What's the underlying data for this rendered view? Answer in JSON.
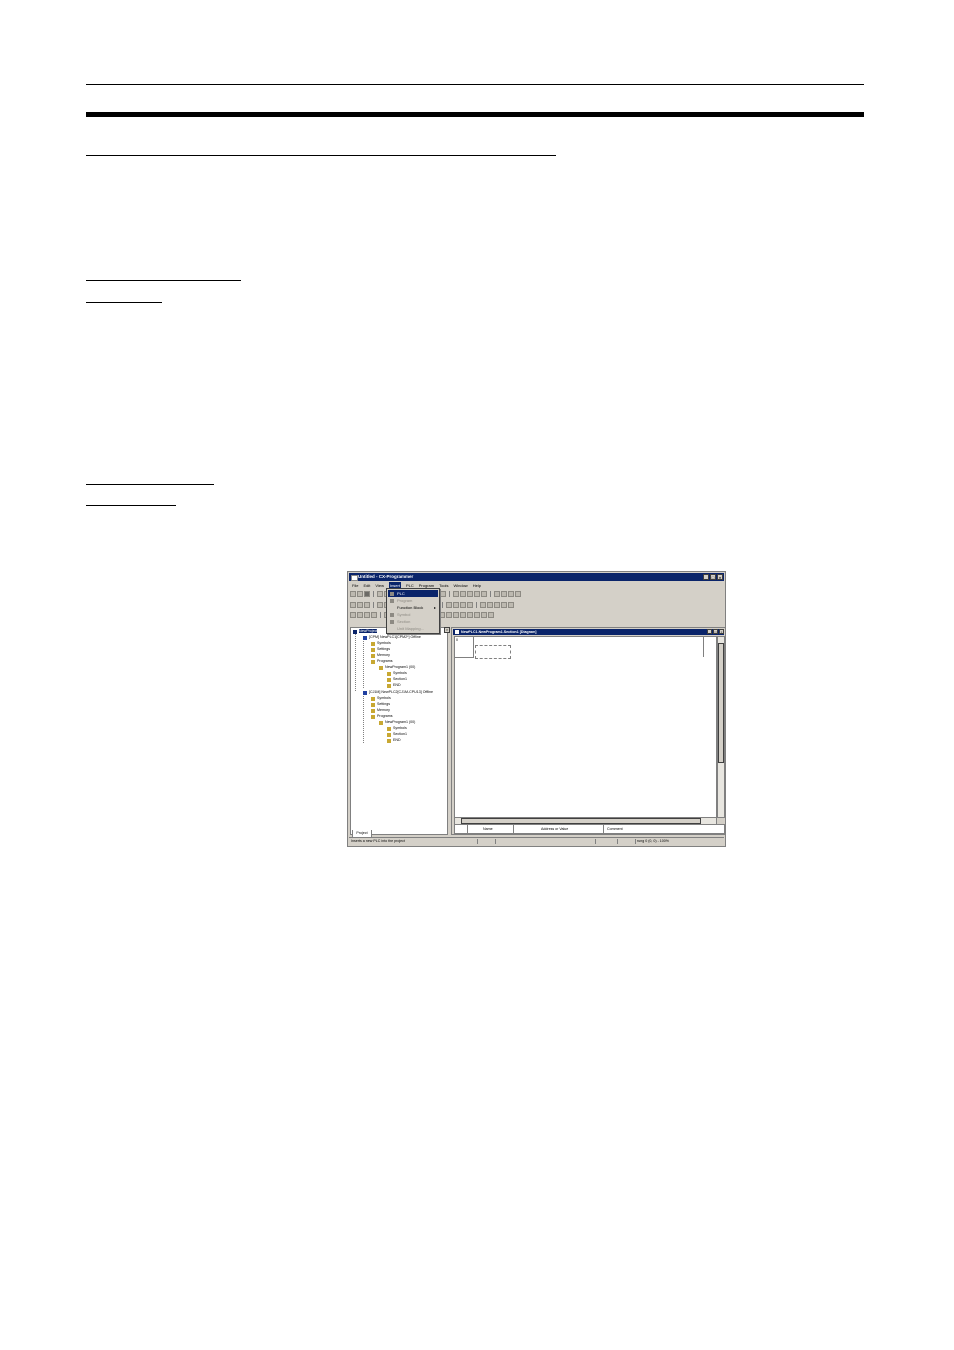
{
  "page": {
    "header_rule": "thin",
    "heading_rule": "thick"
  },
  "screenshot": {
    "window_title": "Untitled - CX-Programmer",
    "window_buttons": [
      "_",
      "□",
      "×"
    ],
    "menu": [
      "File",
      "Edit",
      "View",
      "Insert",
      "PLC",
      "Program",
      "Tools",
      "Window",
      "Help"
    ],
    "active_menu": "Insert",
    "insert_menu_items": [
      {
        "label": "PLC",
        "state": "selected"
      },
      {
        "label": "Program",
        "state": "disabled"
      },
      {
        "label": "Function Block",
        "state": "normal",
        "submenu": true
      },
      {
        "label": "Symbol",
        "state": "disabled"
      },
      {
        "label": "Section",
        "state": "disabled"
      },
      {
        "label": "Unit Mapping...",
        "state": "disabled"
      }
    ],
    "tree": {
      "root": "NewProject",
      "nodes": [
        {
          "label": "[CPM] NewPLC1[CPM2*] Offline",
          "icon": "plc-icon"
        },
        {
          "label": "Symbols",
          "icon": "symbols-icon"
        },
        {
          "label": "Settings",
          "icon": "settings-icon"
        },
        {
          "label": "Memory",
          "icon": "memory-icon"
        },
        {
          "label": "Programs",
          "icon": "programs-icon"
        },
        {
          "label": "NewProgram1 (00)",
          "icon": "program-icon"
        },
        {
          "label": "Symbols",
          "icon": "symbols-icon"
        },
        {
          "label": "Section1",
          "icon": "section-icon"
        },
        {
          "label": "END",
          "icon": "section-icon"
        },
        {
          "label": "[CJ1M] NewPLC2[CJ1M-CPU13] Offline",
          "icon": "plc-icon"
        },
        {
          "label": "Symbols",
          "icon": "symbols-icon"
        },
        {
          "label": "Settings",
          "icon": "settings-icon"
        },
        {
          "label": "Memory",
          "icon": "memory-icon"
        },
        {
          "label": "Programs",
          "icon": "programs-icon"
        },
        {
          "label": "NewProgram1 (00)",
          "icon": "program-icon"
        },
        {
          "label": "Symbols",
          "icon": "symbols-icon"
        },
        {
          "label": "Section1",
          "icon": "section-icon"
        },
        {
          "label": "END",
          "icon": "section-icon"
        }
      ],
      "tab_label": "Project"
    },
    "child_window": {
      "title": "NewPLC1.NewProgram1.Section1 [Diagram]",
      "rung_number": "0",
      "watch_columns": [
        "Name",
        "Address or Value",
        "Comment"
      ]
    },
    "status": {
      "left": "Inserts a new PLC into the project",
      "right": "rung 0 (0, 0) - 100%"
    }
  }
}
